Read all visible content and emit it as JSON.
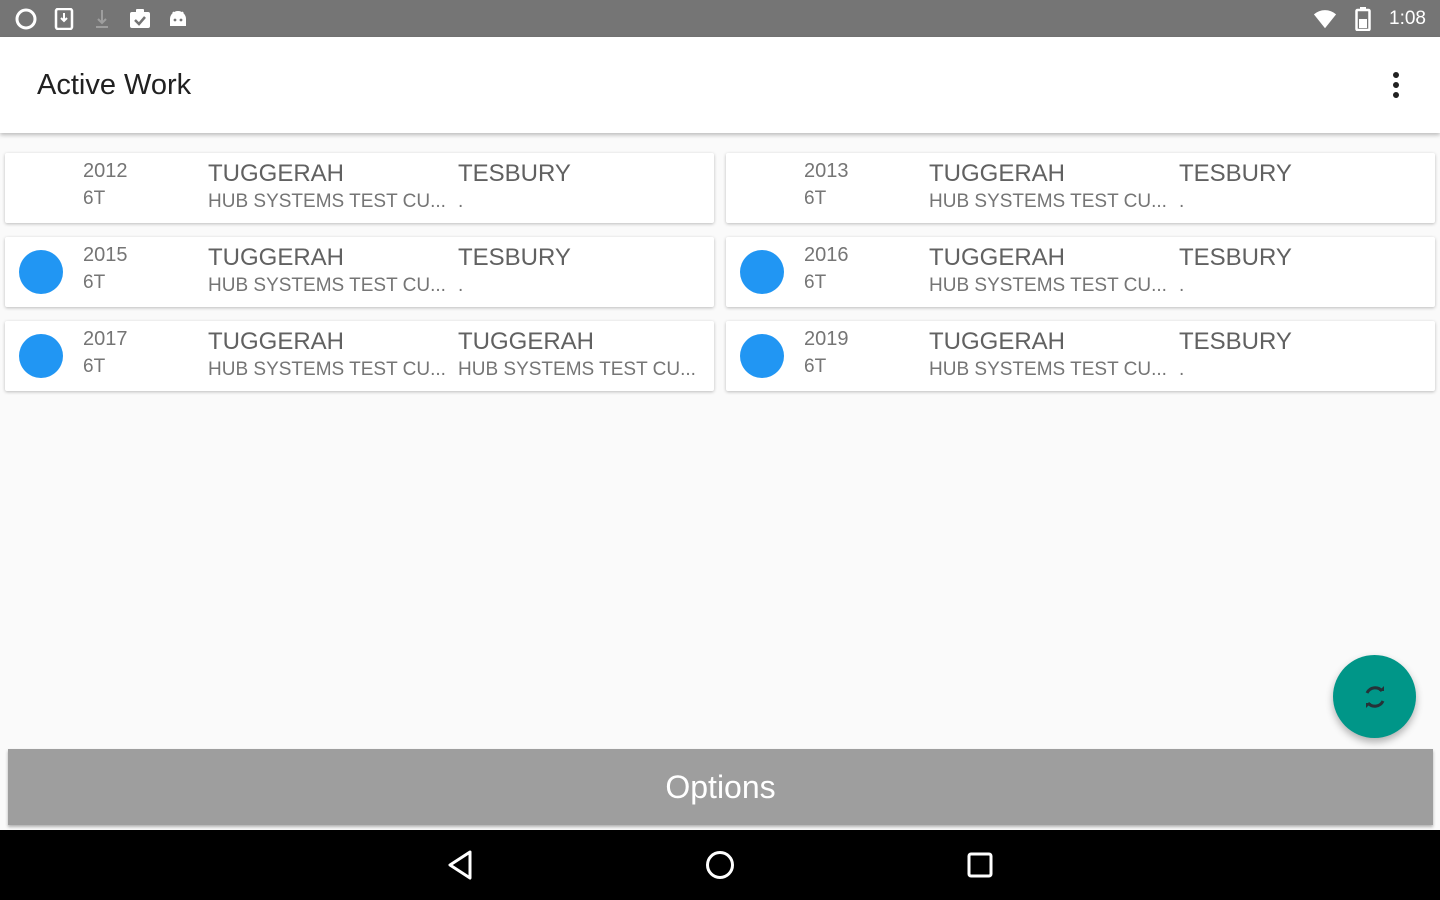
{
  "status_bar": {
    "time": "1:08",
    "left_icons": [
      "sync-circle-icon",
      "sim-download-icon",
      "download-icon",
      "clipboard-check-icon",
      "android-icon"
    ],
    "right_icons": [
      "wifi-icon",
      "battery-icon"
    ]
  },
  "app_bar": {
    "title": "Active Work",
    "overflow_icon": "more-vert-icon"
  },
  "jobs": [
    {
      "id": "2012",
      "code": "6T",
      "from_site": "TUGGERAH",
      "from_client": "HUB SYSTEMS TEST CU...",
      "to_site": "TESBURY",
      "to_client": ".",
      "indicator": false
    },
    {
      "id": "2013",
      "code": "6T",
      "from_site": "TUGGERAH",
      "from_client": "HUB SYSTEMS TEST CU...",
      "to_site": "TESBURY",
      "to_client": ".",
      "indicator": false
    },
    {
      "id": "2015",
      "code": "6T",
      "from_site": "TUGGERAH",
      "from_client": "HUB SYSTEMS TEST CU...",
      "to_site": "TESBURY",
      "to_client": ".",
      "indicator": true
    },
    {
      "id": "2016",
      "code": "6T",
      "from_site": "TUGGERAH",
      "from_client": "HUB SYSTEMS TEST CU...",
      "to_site": "TESBURY",
      "to_client": ".",
      "indicator": true
    },
    {
      "id": "2017",
      "code": "6T",
      "from_site": "TUGGERAH",
      "from_client": "HUB SYSTEMS TEST CU...",
      "to_site": "TUGGERAH",
      "to_client": "HUB SYSTEMS TEST CU...",
      "indicator": true
    },
    {
      "id": "2019",
      "code": "6T",
      "from_site": "TUGGERAH",
      "from_client": "HUB SYSTEMS TEST CU...",
      "to_site": "TESBURY",
      "to_client": ".",
      "indicator": true
    }
  ],
  "colors": {
    "indicator": "#2196f3",
    "fab": "#009688",
    "options_button": "#9e9e9e",
    "status_bar": "#757575"
  },
  "fab": {
    "icon": "sync-icon"
  },
  "options": {
    "label": "Options"
  },
  "nav_bar": {
    "icons": [
      "back-icon",
      "home-icon",
      "recents-icon"
    ]
  }
}
